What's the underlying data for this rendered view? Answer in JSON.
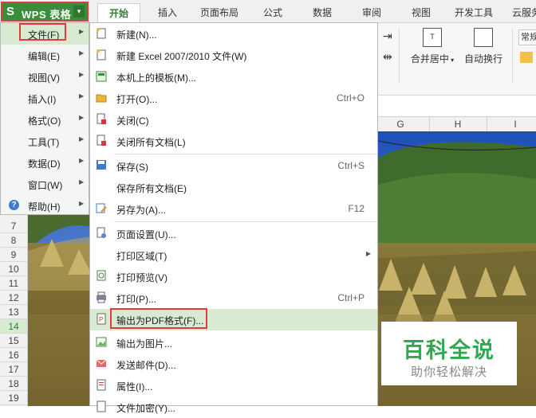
{
  "app": {
    "logo_glyph": "S",
    "name": "WPS 表格",
    "dropdown_glyph": "▾"
  },
  "tabs": [
    {
      "label": "开始",
      "active": true
    },
    {
      "label": "插入"
    },
    {
      "label": "页面布局"
    },
    {
      "label": "公式"
    },
    {
      "label": "数据"
    },
    {
      "label": "审阅"
    },
    {
      "label": "视图"
    },
    {
      "label": "开发工具"
    },
    {
      "label": "云服务"
    }
  ],
  "ribbon": {
    "merge_center": "合并居中",
    "wrap_text": "自动换行",
    "format_partial": "常规",
    "merge_icon_glyph": "T"
  },
  "columns": [
    "G",
    "H",
    "I"
  ],
  "rows": [
    "7",
    "8",
    "9",
    "10",
    "11",
    "12",
    "13",
    "14",
    "15",
    "16",
    "17",
    "18",
    "19"
  ],
  "selected_row": "14",
  "left_menu": [
    {
      "label": "文件(F)",
      "active": true
    },
    {
      "label": "编辑(E)"
    },
    {
      "label": "视图(V)"
    },
    {
      "label": "插入(I)"
    },
    {
      "label": "格式(O)"
    },
    {
      "label": "工具(T)"
    },
    {
      "label": "数据(D)"
    },
    {
      "label": "窗口(W)"
    },
    {
      "label": "帮助(H)"
    }
  ],
  "file_menu": [
    {
      "label": "新建(N)...",
      "icon": "new-icon"
    },
    {
      "label": "新建 Excel 2007/2010 文件(W)",
      "icon": "new-excel-icon"
    },
    {
      "label": "本机上的模板(M)...",
      "icon": "template-icon"
    },
    {
      "label": "打开(O)...",
      "shortcut": "Ctrl+O",
      "icon": "folder-open-icon"
    },
    {
      "label": "关闭(C)",
      "icon": "close-doc-icon"
    },
    {
      "label": "关闭所有文档(L)",
      "icon": "close-all-icon"
    },
    {
      "label": "保存(S)",
      "shortcut": "Ctrl+S",
      "icon": "save-icon"
    },
    {
      "label": "保存所有文档(E)",
      "icon": "save-all-icon"
    },
    {
      "label": "另存为(A)...",
      "shortcut": "F12",
      "icon": "save-as-icon"
    },
    {
      "label": "页面设置(U)...",
      "icon": "page-setup-icon"
    },
    {
      "label": "打印区域(T)",
      "submenu": true,
      "icon": "print-area-icon"
    },
    {
      "label": "打印预览(V)",
      "icon": "print-preview-icon"
    },
    {
      "label": "打印(P)...",
      "shortcut": "Ctrl+P",
      "icon": "print-icon"
    },
    {
      "label": "输出为PDF格式(F)...",
      "highlight": true,
      "icon": "pdf-icon"
    },
    {
      "label": "输出为图片...",
      "icon": "export-image-icon"
    },
    {
      "label": "发送邮件(D)...",
      "icon": "mail-icon"
    },
    {
      "label": "属性(I)...",
      "icon": "properties-icon"
    },
    {
      "label": "文件加密(Y)...",
      "icon": "encrypt-icon"
    }
  ],
  "watermark": {
    "title": "百科全说",
    "subtitle": "助你轻松解决"
  },
  "colors": {
    "wps_green": "#3b8d3b",
    "highlight_red": "#e23b3b",
    "menu_hover": "#d8ead2",
    "watermark_green": "#2fa84f"
  },
  "icons": {
    "help": "?",
    "arrow": "▶"
  }
}
